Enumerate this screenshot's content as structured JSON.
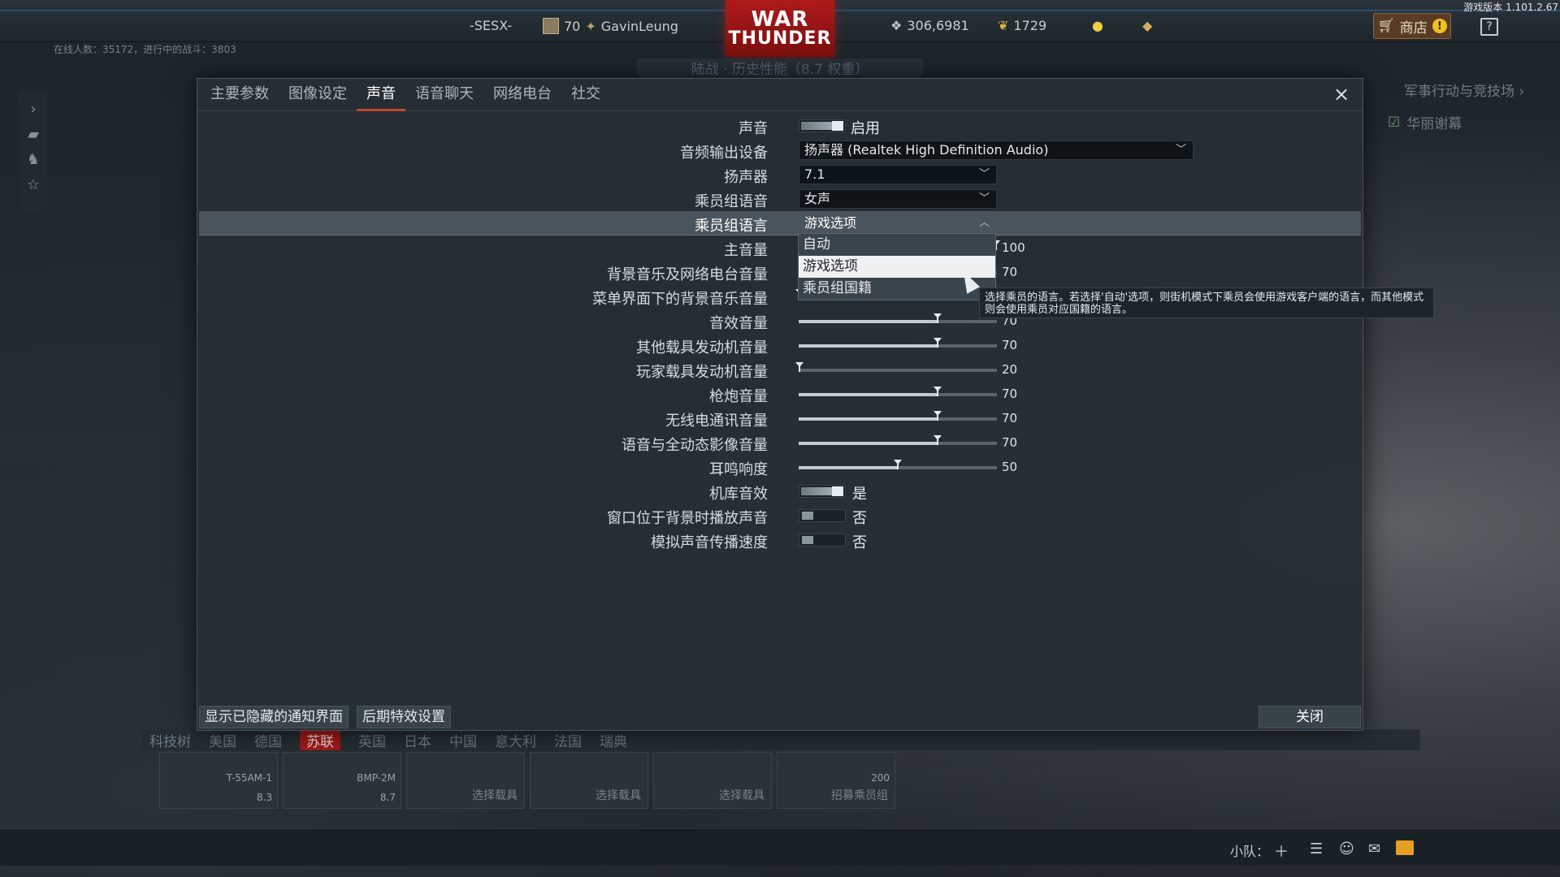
{
  "topbar": {
    "version": "游戏版本 1.101.2.67",
    "squad_tag": "-SESX-",
    "level": "70",
    "username": "GavinLeung",
    "logo_line1": "WAR",
    "logo_line2": "THUNDER",
    "silver_lions": "306,6981",
    "golden_eagles": "1729",
    "shop_label": "商店",
    "help_label": "?",
    "online_info": "在线人数：35172，进行中的战斗：3803",
    "mode_subtitle": "陆战 · 历史性能（8.7 权重）"
  },
  "right_panel": {
    "title": "军事行动与竞技场",
    "unit_name": "华丽谢幕"
  },
  "dialog": {
    "tabs": [
      "主要参数",
      "图像设定",
      "声音",
      "语音聊天",
      "网络电台",
      "社交"
    ],
    "active_tab": 2,
    "close_icon": "×",
    "rows": {
      "sound": {
        "label": "声音",
        "state": "启用"
      },
      "output_device": {
        "label": "音频输出设备",
        "value": "扬声器 (Realtek High Definition Audio)"
      },
      "speaker": {
        "label": "扬声器",
        "value": "7.1"
      },
      "crew_voice": {
        "label": "乘员组语音",
        "value": "女声"
      },
      "crew_language": {
        "label": "乘员组语言",
        "value": "游戏选项"
      },
      "master_volume": {
        "label": "主音量",
        "value": "100"
      },
      "music_radio_volume": {
        "label": "背景音乐及网络电台音量",
        "value": "70"
      },
      "menu_music_volume": {
        "label": "菜单界面下的背景音乐音量",
        "value": "0"
      },
      "sfx_volume": {
        "label": "音效音量",
        "value": "70"
      },
      "other_engine_volume": {
        "label": "其他载具发动机音量",
        "value": "70"
      },
      "player_engine_volume": {
        "label": "玩家载具发动机音量",
        "value": "20"
      },
      "gun_volume": {
        "label": "枪炮音量",
        "value": "70"
      },
      "radio_volume": {
        "label": "无线电通讯音量",
        "value": "70"
      },
      "voice_cinematic_volume": {
        "label": "语音与全动态影像音量",
        "value": "70"
      },
      "tinnitus": {
        "label": "耳鸣响度",
        "value": "50"
      },
      "hangar_sound": {
        "label": "机库音效",
        "state": "是"
      },
      "background_play": {
        "label": "窗口位于背景时播放声音",
        "state": "否"
      },
      "sound_speed": {
        "label": "模拟声音传播速度",
        "state": "否"
      }
    },
    "dropdown_options": [
      "自动",
      "游戏选项",
      "乘员组国籍"
    ],
    "tooltip": "选择乘员的语言。若选择'自动'选项，则街机模式下乘员会使用游戏客户端的语言，而其他模式则会使用乘员对应国籍的语言。",
    "footer": {
      "show_hidden": "显示已隐藏的通知界面",
      "post_fx": "后期特效设置",
      "close": "关闭"
    }
  },
  "hangar": {
    "research_label": "科技树",
    "nations": [
      "美国",
      "德国",
      "苏联",
      "英国",
      "日本",
      "中国",
      "意大利",
      "法国",
      "瑞典"
    ],
    "active_nation": "苏联",
    "slots": [
      {
        "name": "T-55AM-1",
        "br": "8.3"
      },
      {
        "name": "BMP-2M",
        "br": "8.7"
      },
      {
        "action": "选择载具"
      },
      {
        "action": "选择载具"
      },
      {
        "action": "选择载具"
      },
      {
        "cost": "200",
        "action": "招募乘员组"
      }
    ]
  },
  "statusbar": {
    "squad_label": "小队："
  }
}
